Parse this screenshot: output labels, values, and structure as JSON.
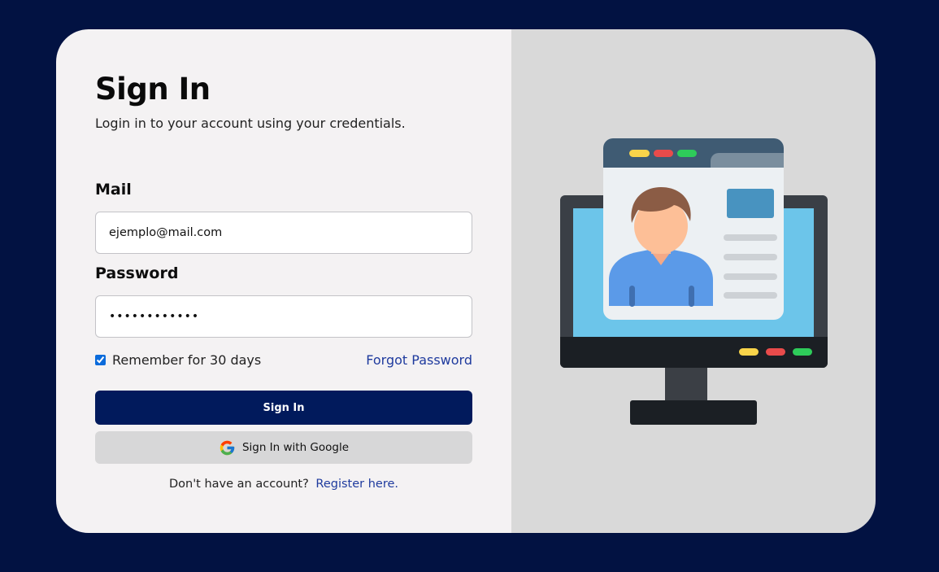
{
  "login": {
    "title": "Sign In",
    "subtitle": "Login in to your account using your credentials.",
    "mail_label": "Mail",
    "mail_value": "ejemplo@mail.com",
    "password_label": "Password",
    "password_value": "••••••••••••",
    "remember_label": "Remember for 30 days",
    "remember_checked": true,
    "forgot_label": "Forgot Password",
    "signin_label": "Sign In",
    "google_label": "Sign In with Google",
    "no_account_text": "Don't have an account?",
    "register_label": "Register here."
  },
  "illustration": {
    "name": "computer-profile-illustration"
  },
  "colors": {
    "page_bg": "#021242",
    "primary_button": "#011a5c",
    "link": "#1f3b9e"
  }
}
